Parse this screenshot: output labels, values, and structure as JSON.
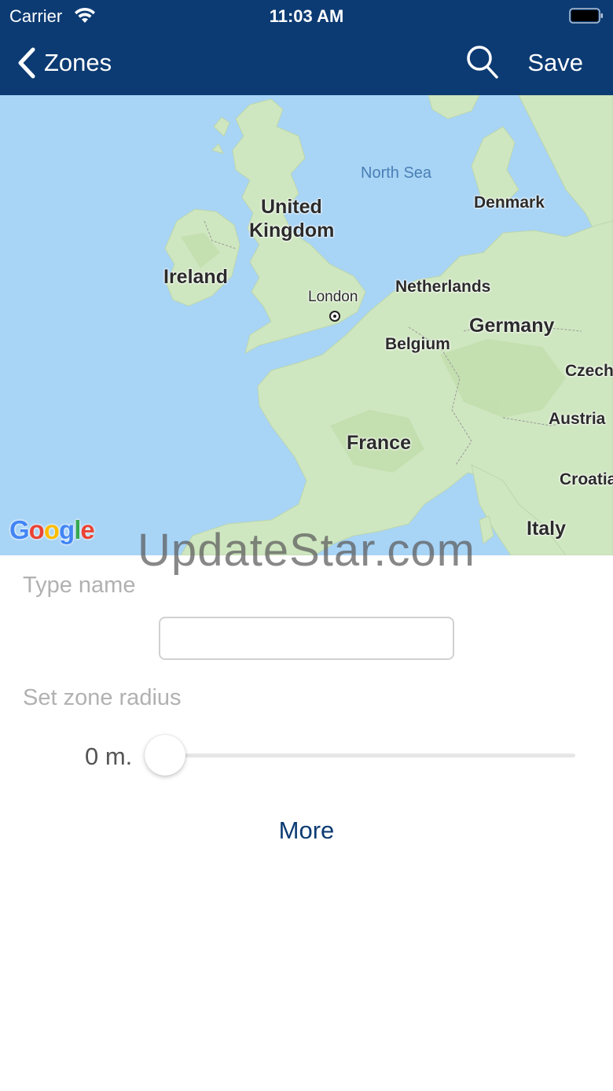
{
  "status_bar": {
    "carrier": "Carrier",
    "time": "11:03 AM",
    "icons": [
      "wifi-icon",
      "battery-icon"
    ]
  },
  "nav": {
    "back_label": "Zones",
    "back_icon": "chevron-left-icon",
    "search_icon": "search-icon",
    "save_label": "Save",
    "background_color": "#0c3b73"
  },
  "map": {
    "labels": {
      "north_sea": "North Sea",
      "united": "United",
      "kingdom": "Kingdom",
      "ireland": "Ireland",
      "london": "London",
      "denmark": "Denmark",
      "netherlands": "Netherlands",
      "germany": "Germany",
      "belgium": "Belgium",
      "czech": "Czech",
      "austria": "Austria",
      "france": "France",
      "croatia": "Croatia",
      "italy": "Italy"
    },
    "attribution": "Google",
    "water_color": "#a8d4f6",
    "land_color": "#cfe7c0"
  },
  "watermark": "UpdateStar.com",
  "form": {
    "name_label": "Type name",
    "name_value": "",
    "radius_label": "Set zone radius",
    "radius_value": "0 m.",
    "radius_slider_fraction": 0,
    "more_label": "More"
  }
}
